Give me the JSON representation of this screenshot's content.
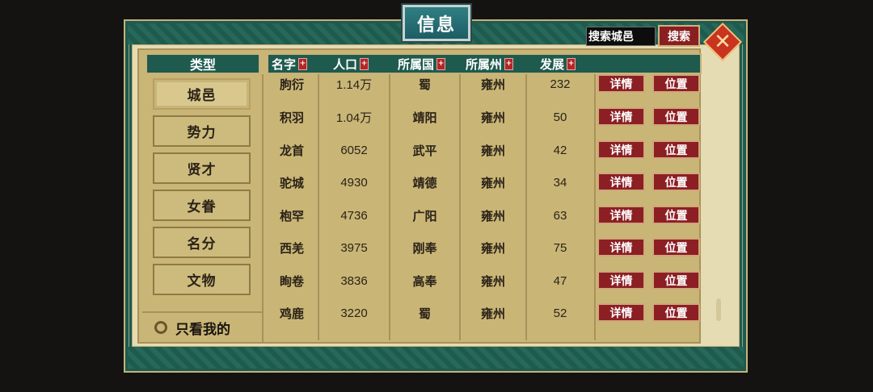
{
  "title": "信息",
  "search": {
    "placeholder": "搜索城邑",
    "button": "搜索"
  },
  "sidebar": {
    "header": "类型",
    "items": [
      "城邑",
      "势力",
      "贤才",
      "女眷",
      "名分",
      "文物"
    ],
    "active": "城邑",
    "only_mine_label": "只看我的"
  },
  "table": {
    "columns": [
      "名字",
      "人口",
      "所属国",
      "所属州",
      "发展"
    ],
    "rows": [
      {
        "name": "朐衍",
        "population": "1.14万",
        "country": "蜀",
        "province": "雍州",
        "development": "232"
      },
      {
        "name": "积羽",
        "population": "1.04万",
        "country": "靖阳",
        "province": "雍州",
        "development": "50"
      },
      {
        "name": "龙首",
        "population": "6052",
        "country": "武平",
        "province": "雍州",
        "development": "42"
      },
      {
        "name": "驼城",
        "population": "4930",
        "country": "靖德",
        "province": "雍州",
        "development": "34"
      },
      {
        "name": "枹罕",
        "population": "4736",
        "country": "广阳",
        "province": "雍州",
        "development": "63"
      },
      {
        "name": "西羌",
        "population": "3975",
        "country": "刚奉",
        "province": "雍州",
        "development": "75"
      },
      {
        "name": "眴卷",
        "population": "3836",
        "country": "高奉",
        "province": "雍州",
        "development": "47"
      },
      {
        "name": "鸡鹿",
        "population": "3220",
        "country": "蜀",
        "province": "雍州",
        "development": "52"
      }
    ],
    "detail_label": "详情",
    "location_label": "位置"
  },
  "colors": {
    "frame_green": "#1f5a4e",
    "parchment": "#c9b676",
    "button_red": "#8c1f24",
    "close_orange": "#c8341f"
  }
}
